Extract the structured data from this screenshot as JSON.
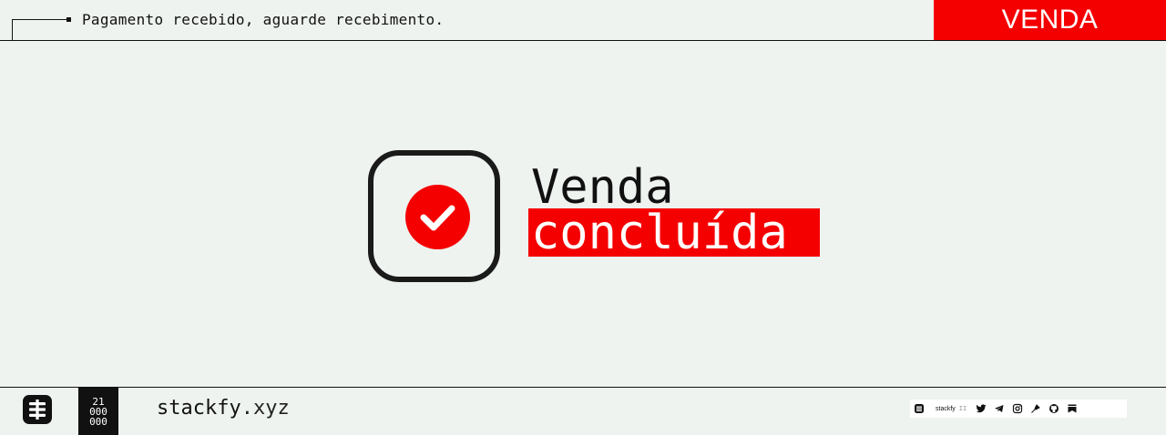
{
  "header": {
    "message": "Pagamento recebido, aguarde recebimento.",
    "badge": "VENDA"
  },
  "main": {
    "title_line1": "Venda",
    "title_line2": "concluída"
  },
  "footer": {
    "counter": [
      "21",
      "000",
      "000"
    ],
    "site_name": "stackfy",
    "site_tld": ".xyz",
    "social_brand": "stackfy",
    "social_separator": "II",
    "social_icons": [
      "document-icon",
      "twitter-icon",
      "telegram-icon",
      "instagram-icon",
      "pen-icon",
      "github-icon",
      "bookmark-icon"
    ]
  },
  "colors": {
    "accent": "#f50000",
    "background": "#eef3ef",
    "ink": "#111111"
  }
}
